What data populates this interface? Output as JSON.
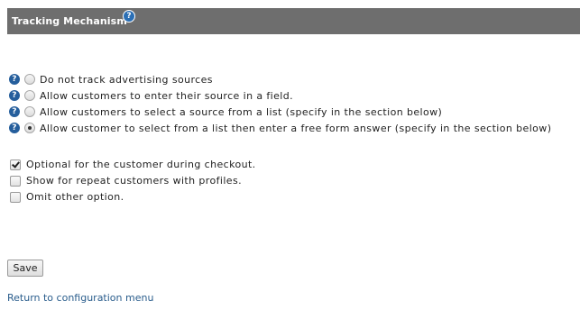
{
  "header": {
    "title": "Tracking Mechanism",
    "help_icon": "question-icon"
  },
  "tracking_options": [
    {
      "label": "Do not track advertising sources",
      "selected": false
    },
    {
      "label": "Allow customers to enter their source in a field.",
      "selected": false
    },
    {
      "label": "Allow customers to select a source from a list (specify in the section below)",
      "selected": false
    },
    {
      "label": "Allow customer to select from a list then enter a free form answer (specify in the section below)",
      "selected": true
    }
  ],
  "checkboxes": [
    {
      "label": "Optional for the customer during checkout.",
      "checked": true
    },
    {
      "label": "Show for repeat customers with profiles.",
      "checked": false
    },
    {
      "label": "Omit other option.",
      "checked": false
    }
  ],
  "save_label": "Save",
  "return_link": "Return to configuration menu",
  "colors": {
    "header_bg": "#6e6e6e",
    "help_icon": "#255e9c",
    "link": "#2a5d8c"
  }
}
